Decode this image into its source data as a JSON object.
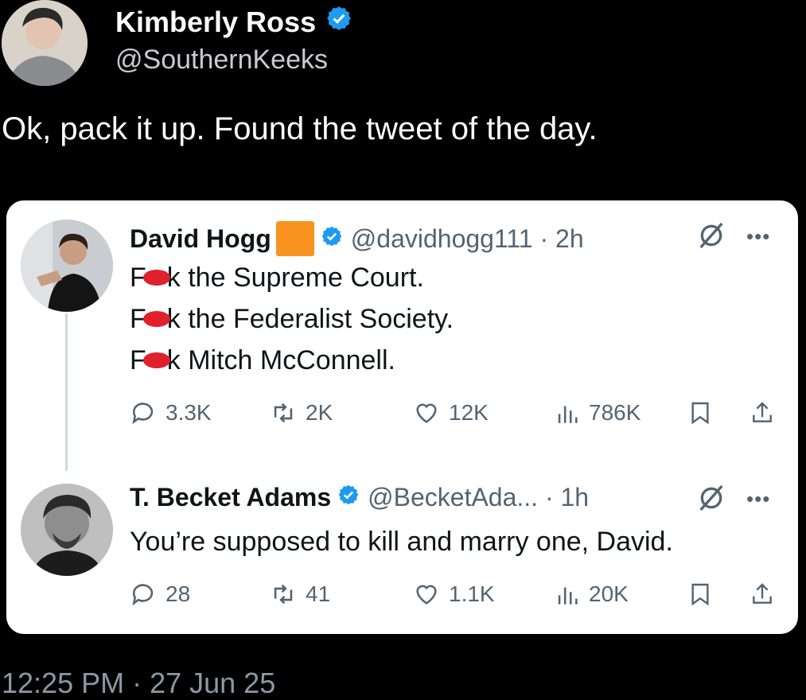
{
  "outer_tweet": {
    "author_name": "Kimberly Ross",
    "author_handle": "@SouthernKeeks",
    "text": "Ok, pack it up. Found the tweet of the day.",
    "timestamp": "12:25 PM · 27 Jun 25"
  },
  "quoted_thread": [
    {
      "author_name": "David Hogg",
      "has_orange_square": true,
      "handle_time": "@davidhogg111 · 2h",
      "lines": [
        {
          "prefix": "F",
          "suffix": "k the Supreme Court."
        },
        {
          "prefix": "F",
          "suffix": "k the Federalist Society."
        },
        {
          "prefix": "F",
          "suffix": "k Mitch McConnell."
        }
      ],
      "stats": {
        "replies": "3.3K",
        "reposts": "2K",
        "likes": "12K",
        "views": "786K"
      }
    },
    {
      "author_name": "T. Becket Adams",
      "handle_time": "@BecketAda... · 1h",
      "text": "You’re supposed to kill and marry one, David.",
      "stats": {
        "replies": "28",
        "reposts": "41",
        "likes": "1.1K",
        "views": "20K"
      }
    }
  ],
  "icons": {
    "verified": "verified-badge-icon",
    "grok": "grok-icon",
    "more": "more-icon",
    "reply": "reply-icon",
    "repost": "repost-icon",
    "like": "like-icon",
    "views": "views-icon",
    "bookmark": "bookmark-icon",
    "share": "share-icon"
  },
  "colors": {
    "verified": "#1d9bf0",
    "orange_square": "#f7931e",
    "secondary_text": "#536471",
    "redaction": "#e0202b"
  }
}
